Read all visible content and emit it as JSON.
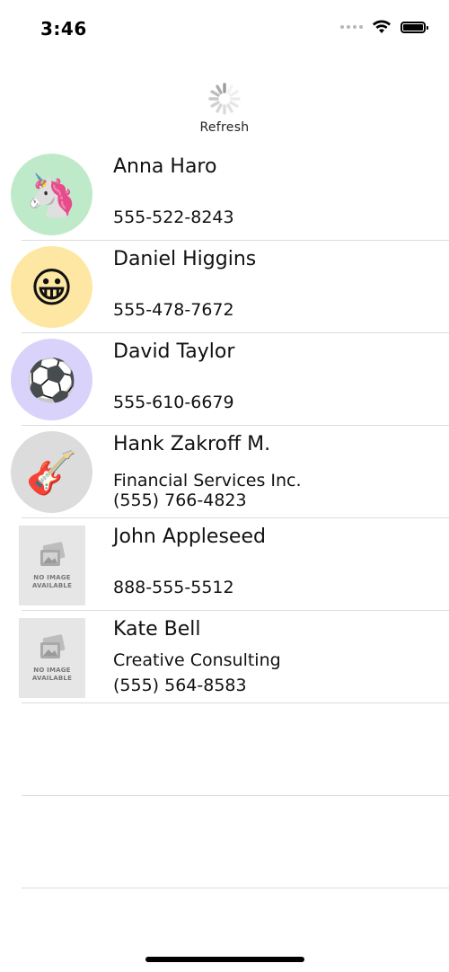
{
  "status_bar": {
    "time": "3:46",
    "icons": [
      "signal-dots",
      "wifi-icon",
      "battery-icon"
    ]
  },
  "refresh": {
    "label": "Refresh",
    "icon": "spinner-icon"
  },
  "contacts": [
    {
      "name": "Anna Haro",
      "company": "",
      "phone": "555-522-8243",
      "avatar": "🦄",
      "avatar_bg": "#bfeac9"
    },
    {
      "name": "Daniel Higgins",
      "company": "",
      "phone": "555-478-7672",
      "avatar": "😀",
      "avatar_bg": "#fde7a2"
    },
    {
      "name": "David Taylor",
      "company": "",
      "phone": "555-610-6679",
      "avatar": "⚽",
      "avatar_bg": "#d9d2fb"
    },
    {
      "name": "Hank Zakroff M.",
      "company": "Financial Services Inc.",
      "phone": "(555) 766-4823",
      "avatar": "🎸",
      "avatar_bg": "#dcdcdc"
    },
    {
      "name": "John Appleseed",
      "company": "",
      "phone": "888-555-5512",
      "placeholder": "NO IMAGE\nAVAILABLE"
    },
    {
      "name": "Kate Bell",
      "company": "Creative Consulting",
      "phone": "(555) 564-8583",
      "placeholder": "NO IMAGE\nAVAILABLE"
    }
  ],
  "colors": {
    "separator": "#dcdcdc",
    "placeholder_bg": "#e6e6e6"
  }
}
